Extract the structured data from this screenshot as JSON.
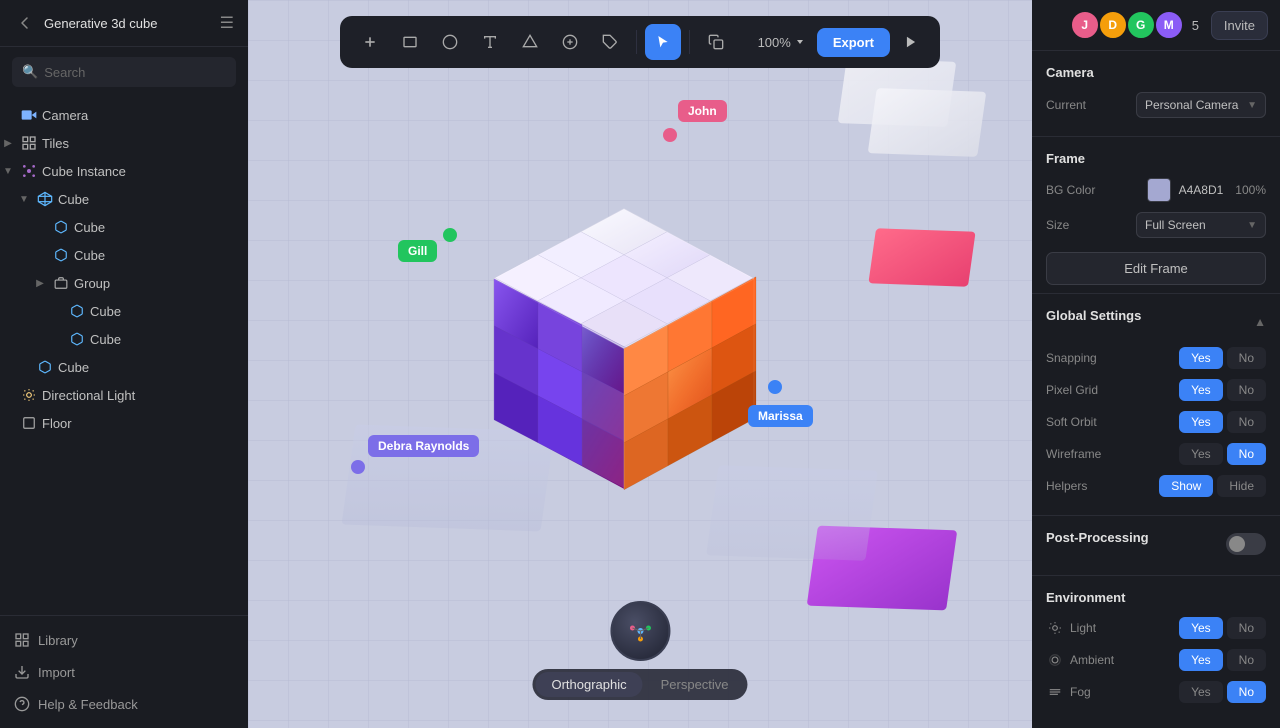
{
  "app": {
    "title": "Generative 3d cube"
  },
  "sidebar": {
    "search_placeholder": "Search",
    "tree": [
      {
        "id": "camera",
        "label": "Camera",
        "icon": "camera",
        "indent": 0,
        "toggle": "none"
      },
      {
        "id": "tiles",
        "label": "Tiles",
        "icon": "tiles",
        "indent": 0,
        "toggle": "expand"
      },
      {
        "id": "cube-instance",
        "label": "Cube Instance",
        "icon": "component",
        "indent": 0,
        "toggle": "collapse"
      },
      {
        "id": "cube-main",
        "label": "Cube",
        "icon": "cube-multi",
        "indent": 1,
        "toggle": "collapse"
      },
      {
        "id": "cube-1",
        "label": "Cube",
        "icon": "cube-sm",
        "indent": 2,
        "toggle": "none"
      },
      {
        "id": "cube-2",
        "label": "Cube",
        "icon": "cube-sm",
        "indent": 2,
        "toggle": "none"
      },
      {
        "id": "group",
        "label": "Group",
        "icon": "group",
        "indent": 2,
        "toggle": "expand"
      },
      {
        "id": "cube-3",
        "label": "Cube",
        "icon": "cube-sm",
        "indent": 3,
        "toggle": "none"
      },
      {
        "id": "cube-4",
        "label": "Cube",
        "icon": "cube-sm",
        "indent": 3,
        "toggle": "none"
      },
      {
        "id": "cube-5",
        "label": "Cube",
        "icon": "cube-sm",
        "indent": 1,
        "toggle": "none"
      },
      {
        "id": "directional-light",
        "label": "Directional Light",
        "icon": "light",
        "indent": 0,
        "toggle": "none"
      },
      {
        "id": "floor",
        "label": "Floor",
        "icon": "floor",
        "indent": 0,
        "toggle": "none"
      }
    ],
    "bottom": [
      {
        "id": "library",
        "label": "Library",
        "icon": "library"
      },
      {
        "id": "import",
        "label": "Import",
        "icon": "import"
      },
      {
        "id": "help",
        "label": "Help & Feedback",
        "icon": "help"
      }
    ]
  },
  "toolbar": {
    "zoom": "100%",
    "export_label": "Export",
    "tools": [
      "add",
      "rectangle",
      "ellipse",
      "text",
      "shape",
      "symbol",
      "tag",
      "cursor",
      "duplicate",
      "play"
    ]
  },
  "canvas": {
    "users": [
      {
        "id": "john",
        "name": "John",
        "color": "#e85d8a"
      },
      {
        "id": "gill",
        "name": "Gill",
        "color": "#22c55e"
      },
      {
        "id": "debra",
        "name": "Debra Raynolds",
        "color": "#7c6ee8"
      },
      {
        "id": "marissa",
        "name": "Marissa",
        "color": "#3b82f6"
      }
    ],
    "view_modes": [
      "Orthographic",
      "Perspective"
    ]
  },
  "right_panel": {
    "avatars": [
      {
        "initial": "J",
        "color": "#e85d8a"
      },
      {
        "initial": "D",
        "color": "#f59e0b"
      },
      {
        "initial": "G",
        "color": "#22c55e"
      },
      {
        "initial": "M",
        "color": "#8b5cf6"
      }
    ],
    "avatar_count": "5",
    "invite_label": "Invite",
    "camera_section": {
      "title": "Camera",
      "current_label": "Current",
      "current_value": "Personal Camera"
    },
    "frame_section": {
      "title": "Frame",
      "bg_color_label": "BG Color",
      "bg_color_hex": "A4A8D1",
      "bg_color_opacity": "100%",
      "size_label": "Size",
      "size_value": "Full Screen",
      "edit_btn": "Edit Frame"
    },
    "global_settings": {
      "title": "Global Settings",
      "rows": [
        {
          "label": "Snapping",
          "yes": true,
          "no": false
        },
        {
          "label": "Pixel Grid",
          "yes": true,
          "no": false
        },
        {
          "label": "Soft Orbit",
          "yes": true,
          "no": false
        },
        {
          "label": "Wireframe",
          "yes": false,
          "no": true
        },
        {
          "label": "Helpers",
          "show": true,
          "hide": false
        }
      ]
    },
    "post_processing": {
      "title": "Post-Processing",
      "enabled": false
    },
    "environment": {
      "title": "Environment",
      "rows": [
        {
          "label": "Light",
          "yes": true
        },
        {
          "label": "Ambient",
          "yes": true
        },
        {
          "label": "Fog",
          "yes": false
        }
      ]
    }
  }
}
